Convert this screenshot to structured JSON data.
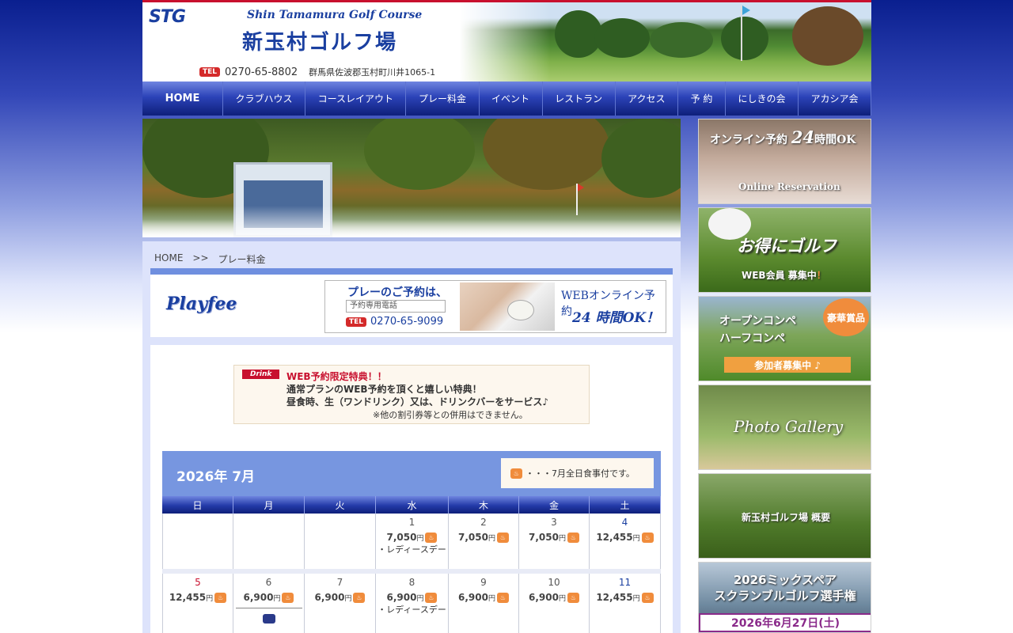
{
  "header": {
    "logo_stg": "STG",
    "logo_en": "Shin Tamamura Golf Course",
    "logo_jp": "新玉村ゴルフ場",
    "tel_badge": "TEL",
    "tel": "0270-65-8802",
    "address": "群馬県佐波郡玉村町川井1065-1"
  },
  "nav": {
    "items": [
      "HOME",
      "クラブハウス",
      "コースレイアウト",
      "プレー料金",
      "イベント",
      "レストラン",
      "アクセス",
      "予 約",
      "にしきの会",
      "アカシア会"
    ]
  },
  "breadcrumb": {
    "home": "HOME",
    "sep": ">>",
    "current": "プレー料金"
  },
  "page_title": "Playfee",
  "reservation_banner": {
    "lead": "プレーのご予約は、",
    "input_placeholder": "予約専用電話",
    "tel_badge": "TEL",
    "tel": "0270-65-9099",
    "online_label": "WEBオンライン予約",
    "hours_label": "24 時間OK！"
  },
  "promo": {
    "tag": "Drink",
    "title": "WEB予約限定特典！！",
    "line1": "通常プランのWEB予約を頂くと嬉しい特典！",
    "line2": "昼食時、生（ワンドリンク）又は、ドリンクバーをサービス♪",
    "note": "※他の割引券等との併用はできません。"
  },
  "calendar": {
    "month_label": "2026年 7月",
    "meal_note": "・・・7月全日食事付です。",
    "meal_icon": "meal-icon",
    "weekdays": [
      "日",
      "月",
      "火",
      "水",
      "木",
      "金",
      "土"
    ],
    "yen": "円",
    "weeks": [
      [
        {
          "day": "",
          "price": "",
          "note": ""
        },
        {
          "day": "",
          "price": "",
          "note": ""
        },
        {
          "day": "",
          "price": "",
          "note": ""
        },
        {
          "day": "1",
          "price": "7,050",
          "note": "・レディースデー"
        },
        {
          "day": "2",
          "price": "7,050",
          "note": ""
        },
        {
          "day": "3",
          "price": "7,050",
          "note": ""
        },
        {
          "day": "4",
          "price": "12,455",
          "note": ""
        }
      ],
      [
        {
          "day": "5",
          "price": "12,455",
          "note": ""
        },
        {
          "day": "6",
          "price": "6,900",
          "note": ""
        },
        {
          "day": "7",
          "price": "6,900",
          "note": ""
        },
        {
          "day": "8",
          "price": "6,900",
          "note": "・レディースデー"
        },
        {
          "day": "9",
          "price": "6,900",
          "note": ""
        },
        {
          "day": "10",
          "price": "6,900",
          "note": ""
        },
        {
          "day": "11",
          "price": "12,455",
          "note": ""
        }
      ]
    ]
  },
  "sidebar": {
    "online": {
      "title_pre": "オンライン予約",
      "title_24": "24",
      "title_post": "時間OK",
      "sub": "Online Reservation"
    },
    "web_member": {
      "title": "お得にゴルフ",
      "sub_pre": "WEB会員 募集中",
      "sub_mark": "！"
    },
    "compe": {
      "line1": "オープンコンペ",
      "line2": "ハーフコンペ",
      "badge": "豪華賞品",
      "strip": "参加者募集中 ♪"
    },
    "gallery": {
      "title": "Photo Gallery"
    },
    "overview": {
      "title": "新玉村ゴルフ場 概要"
    },
    "event": {
      "line1": "2026ミックスペア",
      "line2": "スクランブルゴルフ選手権",
      "date": "2026年6月27日(土)"
    }
  }
}
